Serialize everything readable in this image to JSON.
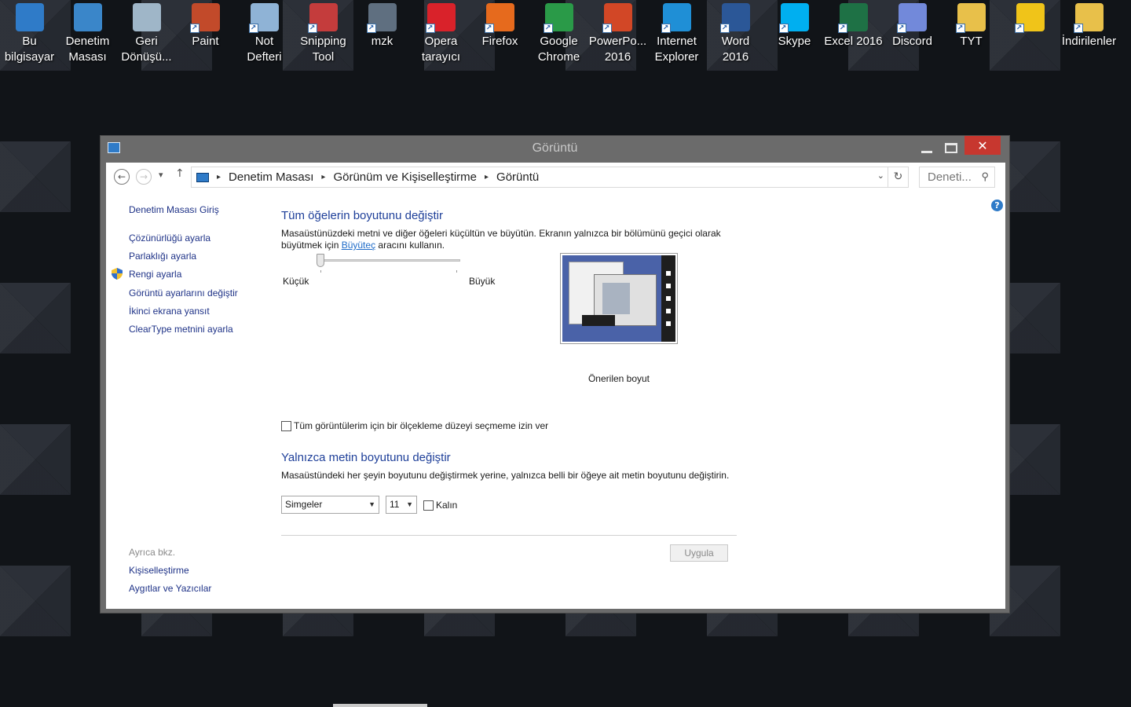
{
  "desktop": {
    "icons": [
      {
        "label": "Bu\nbilgisayar",
        "icon": "computer-icon",
        "color": "#2f7bc8"
      },
      {
        "label": "Denetim\nMasası",
        "icon": "control-panel-icon",
        "color": "#3a86c9"
      },
      {
        "label": "Geri\nDönüşü...",
        "icon": "recycle-bin-icon",
        "color": "#9fb6c8"
      },
      {
        "label": "Paint",
        "icon": "paint-icon",
        "color": "#c24a2a"
      },
      {
        "label": "Not\nDefteri",
        "icon": "notepad-icon",
        "color": "#8fb3d6"
      },
      {
        "label": "Snipping\nTool",
        "icon": "scissors-icon",
        "color": "#c43c3c"
      },
      {
        "label": "mzk",
        "icon": "music-folder-icon",
        "color": "#5f6f80"
      },
      {
        "label": "Opera\ntarayıcı",
        "icon": "opera-icon",
        "color": "#d9222a"
      },
      {
        "label": "Firefox",
        "icon": "firefox-icon",
        "color": "#e66a1d"
      },
      {
        "label": "Google\nChrome",
        "icon": "chrome-icon",
        "color": "#2a9a48"
      },
      {
        "label": "PowerPo...\n2016",
        "icon": "powerpoint-icon",
        "color": "#d24726"
      },
      {
        "label": "Internet\nExplorer",
        "icon": "ie-icon",
        "color": "#1f8fd6"
      },
      {
        "label": "Word\n2016",
        "icon": "word-icon",
        "color": "#2b5797"
      },
      {
        "label": "Skype",
        "icon": "skype-icon",
        "color": "#00aff0"
      },
      {
        "label": "Excel 2016",
        "icon": "excel-icon",
        "color": "#1e7145"
      },
      {
        "label": "Discord",
        "icon": "discord-icon",
        "color": "#7289da"
      },
      {
        "label": "TYT",
        "icon": "folder-icon",
        "color": "#e8c04a"
      },
      {
        "label": "",
        "icon": "settings-gear-icon",
        "color": "#f0c419"
      },
      {
        "label": "İndirilenler",
        "icon": "downloads-folder-icon",
        "color": "#e8c04a"
      }
    ]
  },
  "window": {
    "title": "Görüntü",
    "close_glyph": "✕",
    "address": {
      "crumbs": [
        "Denetim Masası",
        "Görünüm ve Kişiselleştirme",
        "Görüntü"
      ],
      "search_placeholder": "Deneti..."
    },
    "help_glyph": "?",
    "left_pane": {
      "home": "Denetim Masası Giriş",
      "links": [
        "Çözünürlüğü ayarla",
        "Parlaklığı ayarla",
        "Rengi ayarla",
        "Görüntü ayarlarını değiştir",
        "İkinci ekrana yansıt",
        "ClearType metnini ayarla"
      ],
      "see_also_title": "Ayrıca bkz.",
      "see_also": [
        "Kişiselleştirme",
        "Aygıtlar ve Yazıcılar"
      ]
    },
    "main": {
      "heading1": "Tüm öğelerin boyutunu değiştir",
      "desc1_part1": "Masaüstünüzdeki metni ve diğer öğeleri küçültün ve büyütün. Ekranın yalnızca bir bölümünü geçici olarak büyütmek için ",
      "desc1_link": "Büyüteç",
      "desc1_part2": " aracını kullanın.",
      "slider_min_label": "Küçük",
      "slider_max_label": "Büyük",
      "slider_value": 0,
      "preview_caption": "Önerilen boyut",
      "scaling_checkbox_label": "Tüm görüntülerim için bir ölçekleme düzeyi seçmeme izin ver",
      "scaling_checked": false,
      "heading2": "Yalnızca metin boyutunu değiştir",
      "desc2": "Masaüstündeki her şeyin boyutunu değiştirmek yerine, yalnızca belli bir öğeye ait metin boyutunu değiştirin.",
      "item_select": "Simgeler",
      "size_select": "11",
      "bold_label": "Kalın",
      "bold_checked": false,
      "apply_label": "Uygula"
    }
  }
}
